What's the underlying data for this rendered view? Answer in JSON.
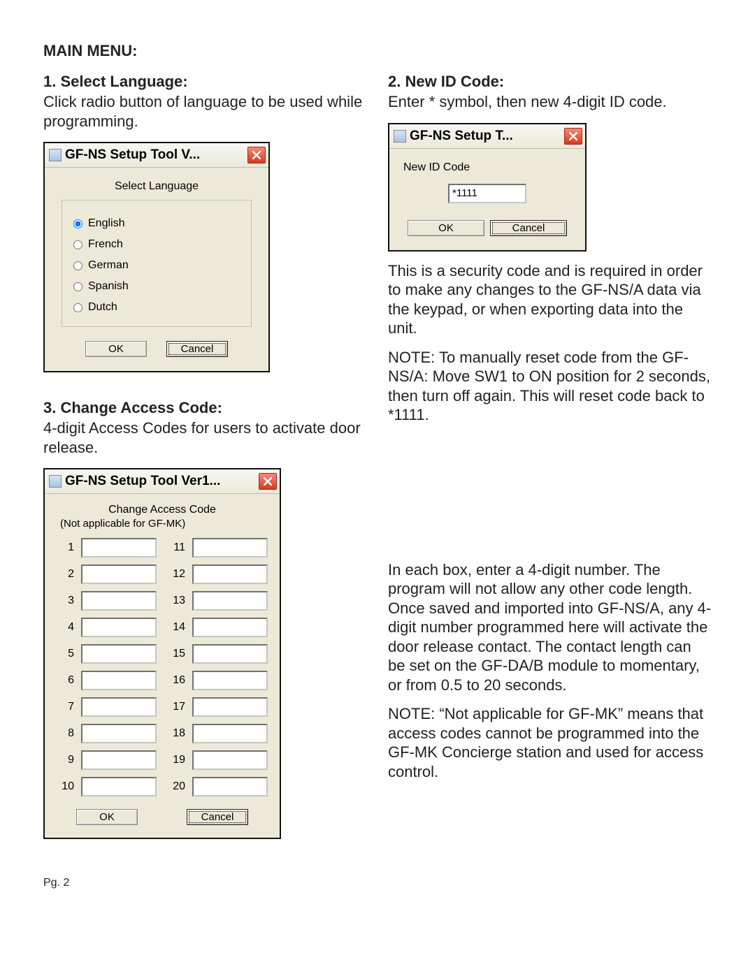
{
  "mainHeading": "MAIN MENU:",
  "pageNum": "Pg. 2",
  "sec1": {
    "heading": "1. Select Language:",
    "desc": "Click radio button of language to be used while programming."
  },
  "dlgLang": {
    "title": "GF-NS Setup Tool V...",
    "label": "Select Language",
    "options": [
      "English",
      "French",
      "German",
      "Spanish",
      "Dutch"
    ],
    "selectedIndex": 0,
    "ok": "OK",
    "cancel": "Cancel"
  },
  "sec2": {
    "heading": "2. New ID Code:",
    "desc": "Enter * symbol, then new 4-digit ID code.",
    "para1": "This is a security code and is required in order to make any changes to the GF-NS/A data via the keypad, or when exporting data into the unit.",
    "para2": "NOTE: To manually reset code from the GF-NS/A: Move SW1 to ON position for 2 seconds, then turn off again. This will reset code back to *1111."
  },
  "dlgId": {
    "title": "GF-NS Setup T...",
    "fieldLabel": "New ID Code",
    "value": "*1111",
    "ok": "OK",
    "cancel": "Cancel"
  },
  "sec3": {
    "heading": "3. Change Access Code:",
    "desc": "4-digit Access Codes for users to activate door release.",
    "para1": "In each box, enter a 4-digit number. The program will not allow any other code length. Once saved and imported into GF-NS/A, any 4-digit number programmed here will activate the door release contact. The contact length can be set on the GF-DA/B module to momentary, or from 0.5 to 20 seconds.",
    "para2": "NOTE: “Not applicable for GF-MK” means that access codes cannot be programmed into the GF-MK Concierge station and used for access control."
  },
  "dlgAcc": {
    "title": "GF-NS Setup Tool Ver1...",
    "header": "Change Access Code",
    "sub": "(Not applicable for GF-MK)",
    "leftNums": [
      "1",
      "2",
      "3",
      "4",
      "5",
      "6",
      "7",
      "8",
      "9",
      "10"
    ],
    "rightNums": [
      "11",
      "12",
      "13",
      "14",
      "15",
      "16",
      "17",
      "18",
      "19",
      "20"
    ],
    "ok": "OK",
    "cancel": "Cancel"
  }
}
